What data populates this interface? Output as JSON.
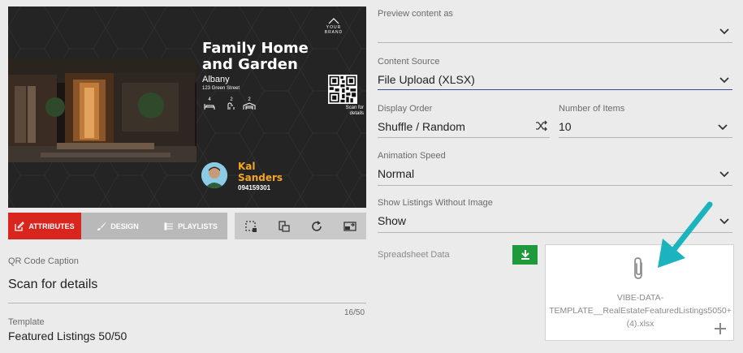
{
  "preview": {
    "brand": "YOUR BRAND",
    "title": "Family Home and Garden",
    "city": "Albany",
    "street": "123 Green Street",
    "features": [
      {
        "count": "4",
        "icon": "bed-icon"
      },
      {
        "count": "2",
        "icon": "bath-icon"
      },
      {
        "count": "2",
        "icon": "garage-icon"
      }
    ],
    "qr_caption": "Scan for details",
    "agent_first": "Kal",
    "agent_last": "Sanders",
    "agent_phone": "094159301",
    "colors": {
      "background": "#242424",
      "accent": "#f5a623"
    }
  },
  "tabs": [
    {
      "label": "ATTRIBUTES",
      "icon": "edit-icon",
      "active": true
    },
    {
      "label": "DESIGN",
      "icon": "brush-icon",
      "active": false
    },
    {
      "label": "PLAYLISTS",
      "icon": "list-icon",
      "active": false
    }
  ],
  "tools": [
    "select-area-icon",
    "layers-icon",
    "refresh-icon",
    "screen-share-icon"
  ],
  "fields": {
    "qr_caption_label": "QR Code Caption",
    "qr_caption_value": "Scan for details",
    "char_count": "16/50",
    "template_label": "Template",
    "template_value": "Featured Listings 50/50"
  },
  "settings": {
    "preview_label": "Preview content as",
    "preview_value": "",
    "source_label": "Content Source",
    "source_value": "File Upload (XLSX)",
    "order_label": "Display Order",
    "order_value": "Shuffle / Random",
    "items_label": "Number of Items",
    "items_value": "10",
    "speed_label": "Animation Speed",
    "speed_value": "Normal",
    "without_image_label": "Show Listings Without Image",
    "without_image_value": "Show",
    "spreadsheet_label": "Spreadsheet Data",
    "file_name": [
      "VIBE-DATA-",
      "TEMPLATE__RealEstateFeaturedListings5050+",
      "(4).xlsx"
    ]
  }
}
